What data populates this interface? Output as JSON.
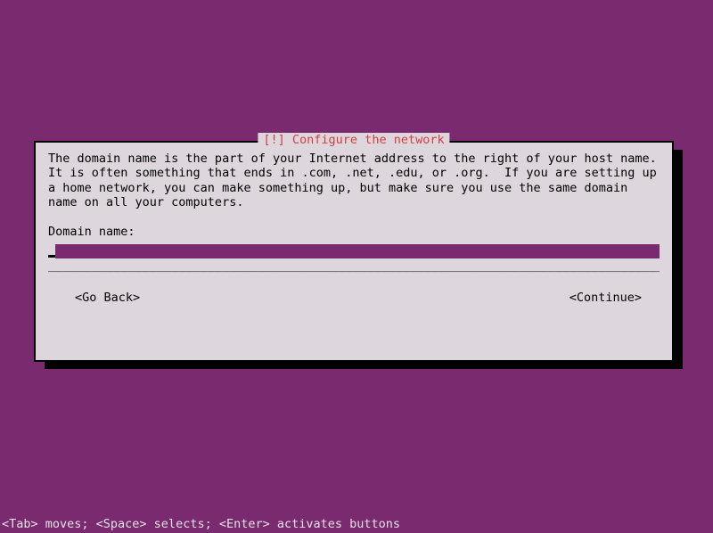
{
  "dialog": {
    "title": "[!] Configure the network",
    "description": "The domain name is the part of your Internet address to the right of your host name.  It is often something that ends in .com, .net, .edu, or .org.  If you are setting up a home network, you can make something up, but make sure you use the same domain name on all your computers.",
    "field_label": "Domain name:",
    "input_value": "",
    "go_back_label": "<Go Back>",
    "continue_label": "<Continue>"
  },
  "footer": {
    "help": "<Tab> moves; <Space> selects; <Enter> activates buttons"
  },
  "underscore_line": "_________________________________________________________________________________________"
}
